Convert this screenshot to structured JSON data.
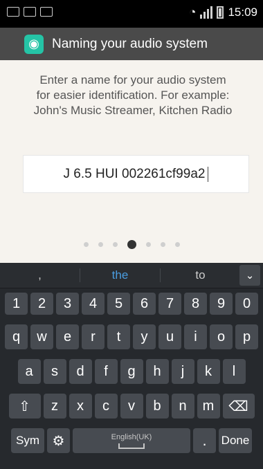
{
  "status_bar": {
    "time": "15:09"
  },
  "action_bar": {
    "title": "Naming your audio system"
  },
  "instructions": {
    "line1": "Enter a name for your audio system",
    "line2": "for easier identification. For example:",
    "line3": "John's Music Streamer, Kitchen Radio"
  },
  "name_input": {
    "value": "J 6.5 HUI 002261cf99a2"
  },
  "pager": {
    "total_pages": 7,
    "current_page": 4
  },
  "keyboard": {
    "suggestions": [
      ",",
      "the",
      "to"
    ],
    "numbers": [
      "1",
      "2",
      "3",
      "4",
      "5",
      "6",
      "7",
      "8",
      "9",
      "0"
    ],
    "row1": [
      "q",
      "w",
      "e",
      "r",
      "t",
      "y",
      "u",
      "i",
      "o",
      "p"
    ],
    "row2": [
      "a",
      "s",
      "d",
      "f",
      "g",
      "h",
      "j",
      "k",
      "l"
    ],
    "row3": [
      "z",
      "x",
      "c",
      "v",
      "b",
      "n",
      "m"
    ],
    "sym_label": "Sym",
    "space_label": "English(UK)",
    "period_label": ".",
    "done_label": "Done",
    "shift_symbol": "⇧",
    "backspace_symbol": "⌫",
    "settings_symbol": "⚙",
    "collapse_symbol": "⌄"
  },
  "colors": {
    "accent": "#25c4a6",
    "suggestion_highlight": "#4a9de0"
  }
}
